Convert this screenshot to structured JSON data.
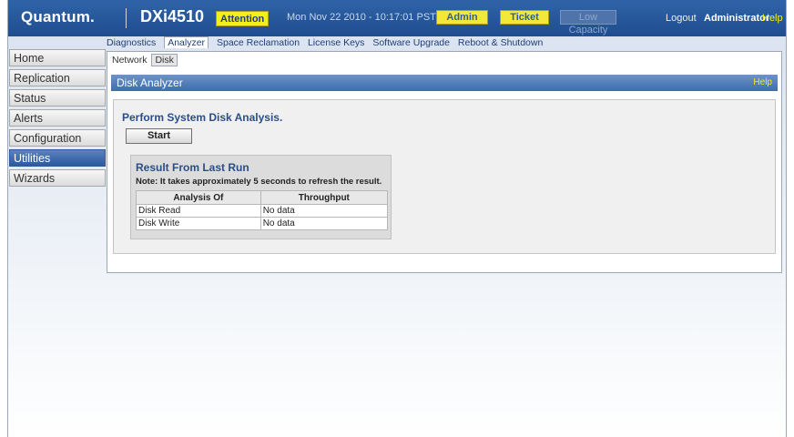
{
  "header": {
    "logo": "Quantum.",
    "model": "DXi4510",
    "attention": "Attention",
    "datetime": "Mon Nov 22 2010 - 10:17:01 PST",
    "admin_button": "Admin",
    "ticket_button": "Ticket",
    "low_capacity_button": "Low Capacity",
    "logout": "Logout",
    "user": "Administrator",
    "help": "Help"
  },
  "top_tabs": [
    {
      "label": "Diagnostics"
    },
    {
      "label": "Analyzer"
    },
    {
      "label": "Space Reclamation"
    },
    {
      "label": "License Keys"
    },
    {
      "label": "Software Upgrade"
    },
    {
      "label": "Reboot & Shutdown"
    }
  ],
  "active_top_tab": "Analyzer",
  "sub_tabs": [
    {
      "label": "Network"
    },
    {
      "label": "Disk"
    }
  ],
  "active_sub_tab": "Disk",
  "nav": [
    {
      "label": "Home"
    },
    {
      "label": "Replication"
    },
    {
      "label": "Status"
    },
    {
      "label": "Alerts"
    },
    {
      "label": "Configuration"
    },
    {
      "label": "Utilities"
    },
    {
      "label": "Wizards"
    }
  ],
  "active_nav": "Utilities",
  "panel": {
    "title": "Disk Analyzer",
    "help": "Help",
    "perform_text": "Perform System Disk Analysis.",
    "start_button": "Start",
    "result": {
      "title": "Result From Last Run",
      "note": "Note: It takes approximately 5 seconds to refresh the result.",
      "columns": [
        "Analysis Of",
        "Throughput"
      ],
      "rows": [
        [
          "Disk Read",
          "No data"
        ],
        [
          "Disk Write",
          "No data"
        ]
      ]
    }
  },
  "colors": {
    "header_blue": "#2f63a8",
    "accent_yellow": "#f4ef1a",
    "nav_active": "#2b5a9e"
  }
}
